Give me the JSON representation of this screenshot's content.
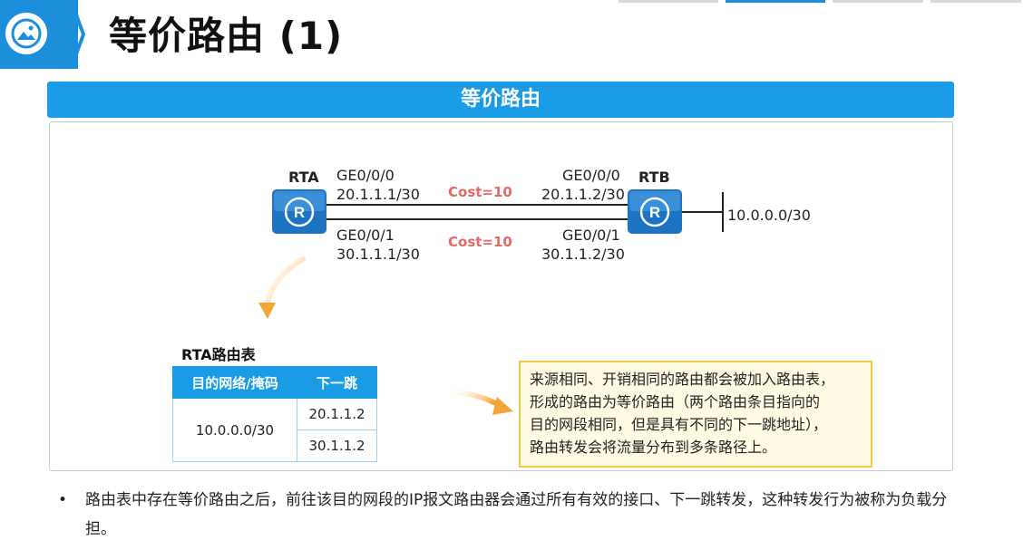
{
  "header": {
    "title": "等价路由 (1)",
    "logo_icon": "image-icon",
    "accent_color": "#1b8fdc"
  },
  "banner": {
    "title": "等价路由"
  },
  "diagram": {
    "router_a": {
      "name": "RTA",
      "icon": "router-icon"
    },
    "router_b": {
      "name": "RTB",
      "icon": "router-icon"
    },
    "link1": {
      "a_interface": "GE0/0/0",
      "a_ip": "20.1.1.1/30",
      "b_interface": "GE0/0/0",
      "b_ip": "20.1.1.2/30",
      "cost": "Cost=10"
    },
    "link2": {
      "a_interface": "GE0/0/1",
      "a_ip": "30.1.1.1/30",
      "b_interface": "GE0/0/1",
      "b_ip": "30.1.1.2/30",
      "cost": "Cost=10"
    },
    "network": "10.0.0.0/30",
    "cost_color": "#e26a63"
  },
  "routing_table": {
    "caption": "RTA路由表",
    "headers": [
      "目的网络/掩码",
      "下一跳"
    ],
    "destination": "10.0.0.0/30",
    "next_hops": [
      "20.1.1.2",
      "30.1.1.2"
    ]
  },
  "note": {
    "lines": [
      "来源相同、开销相同的路由都会被加入路由表，",
      "形成的路由为等价路由（两个路由条目指向的",
      "目的网段相同，但是具有不同的下一跳地址），",
      "路由转发会将流量分布到多条路径上。"
    ]
  },
  "bullet": {
    "marker": "•",
    "text": "路由表中存在等价路由之后，前往该目的网段的IP报文路由器会通过所有有效的接口、下一跳转发，这种转发行为被称为负载分担。"
  }
}
